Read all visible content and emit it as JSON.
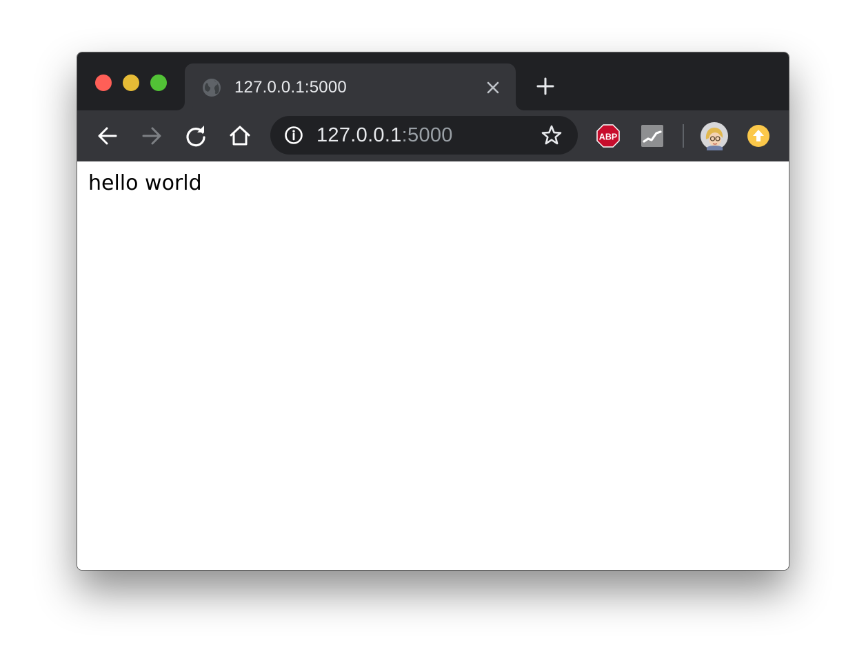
{
  "colors": {
    "traffic_close": "#ff5f57",
    "traffic_minimize": "#e6bb36",
    "traffic_maximize": "#52c236",
    "frame_dark": "#202124",
    "toolbar": "#35363a",
    "icon": "#ffffff",
    "icon_disabled": "#7d8084",
    "url_dim": "#9aa0a6",
    "abp_red": "#c70d2c",
    "update_badge": "#fbc84a"
  },
  "tab": {
    "title": "127.0.0.1:5000",
    "favicon": "globe-icon",
    "close_icon": "close-icon"
  },
  "new_tab_icon": "plus-icon",
  "toolbar": {
    "back_icon": "arrow-left-icon",
    "forward_icon": "arrow-right-icon",
    "reload_icon": "reload-icon",
    "home_icon": "home-icon"
  },
  "omnibox": {
    "info_icon": "info-icon",
    "host": "127.0.0.1",
    "port": ":5000",
    "star_icon": "star-icon"
  },
  "extensions": {
    "abp_label": "ABP",
    "analytics_icon": "chart-icon",
    "avatar": "avatar",
    "update_icon": "upload-arrow-icon"
  },
  "page": {
    "body_text": "hello world"
  }
}
